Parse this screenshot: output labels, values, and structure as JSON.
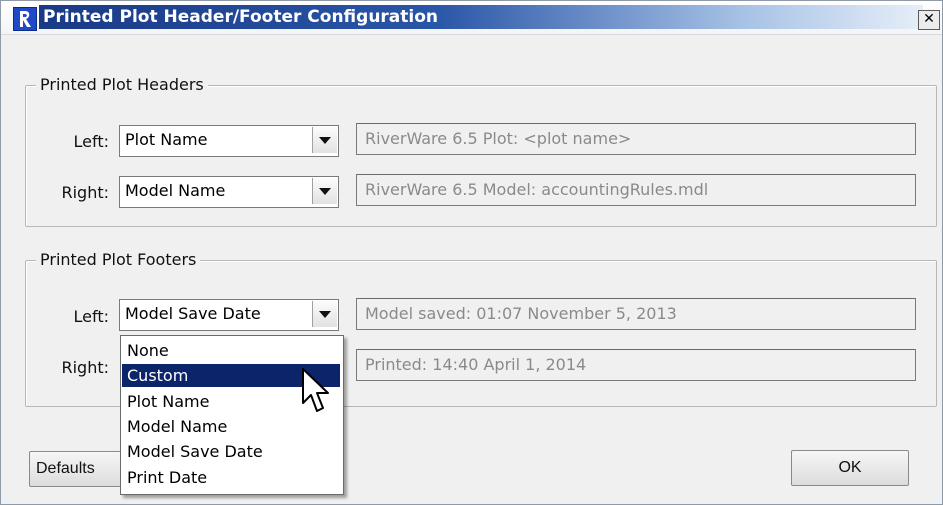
{
  "window": {
    "title": "Printed Plot Header/Footer Configuration",
    "close_glyph": "✕"
  },
  "headers": {
    "group_title": "Printed Plot Headers",
    "left": {
      "label": "Left:",
      "selected": "Plot Name",
      "preview": "RiverWare 6.5 Plot: <plot name>"
    },
    "right": {
      "label": "Right:",
      "selected": "Model Name",
      "preview": "RiverWare 6.5 Model: accountingRules.mdl"
    }
  },
  "footers": {
    "group_title": "Printed Plot Footers",
    "left": {
      "label": "Left:",
      "selected": "Model Save Date",
      "preview": "Model saved: 01:07 November 5, 2013"
    },
    "right": {
      "label": "Right:",
      "preview": "Printed: 14:40 April 1, 2014"
    }
  },
  "dropdown": {
    "options": [
      "None",
      "Custom",
      "Plot Name",
      "Model Name",
      "Model Save Date",
      "Print Date"
    ],
    "highlighted": "Custom"
  },
  "buttons": {
    "defaults": "Defaults",
    "ok": "OK"
  },
  "colors": {
    "title_gradient_start": "#1a3a86",
    "selection": "#0b246a"
  }
}
